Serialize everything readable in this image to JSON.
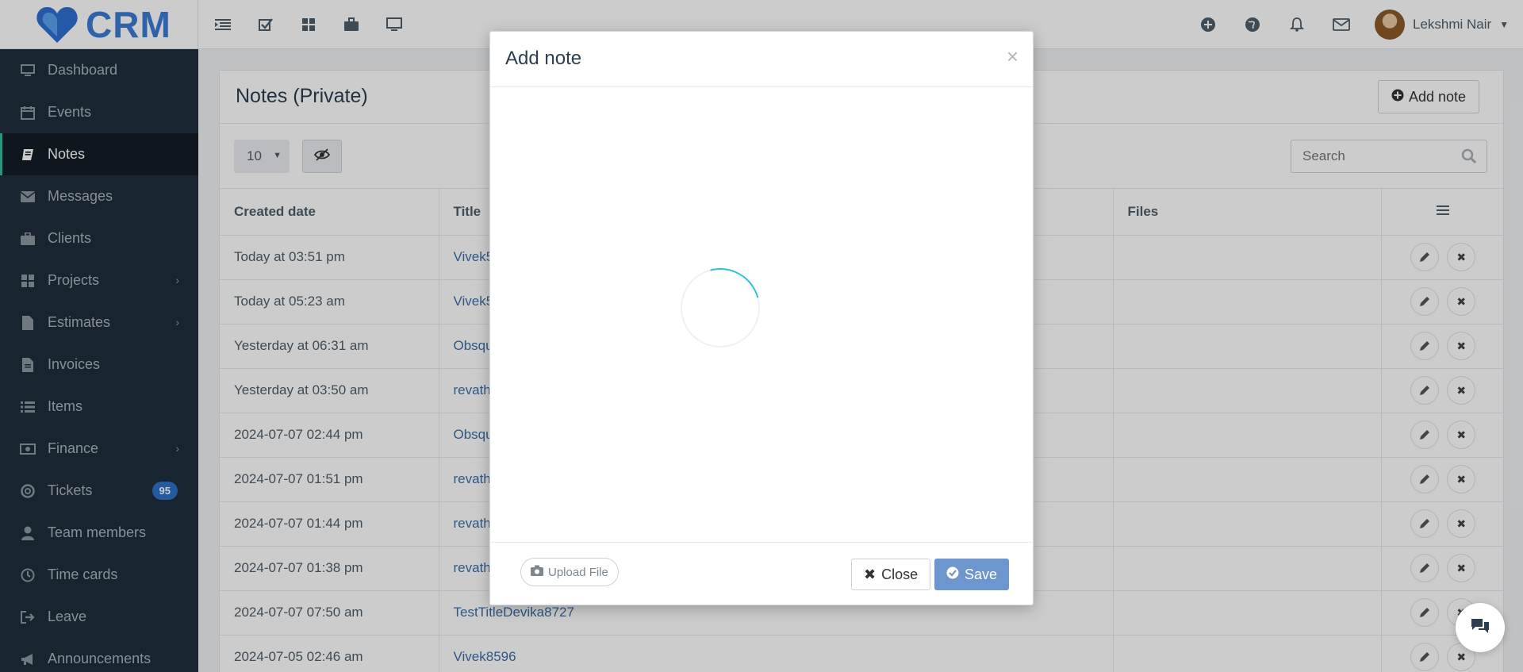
{
  "app": {
    "logo_text": "CRM"
  },
  "user": {
    "name": "Lekshmi Nair"
  },
  "sidebar": {
    "items": [
      {
        "label": "Dashboard",
        "icon": "desktop-icon"
      },
      {
        "label": "Events",
        "icon": "calendar-icon"
      },
      {
        "label": "Notes",
        "icon": "book-icon",
        "active": true
      },
      {
        "label": "Messages",
        "icon": "envelope-icon"
      },
      {
        "label": "Clients",
        "icon": "briefcase-icon"
      },
      {
        "label": "Projects",
        "icon": "grid-icon",
        "has_submenu": true
      },
      {
        "label": "Estimates",
        "icon": "file-icon",
        "has_submenu": true
      },
      {
        "label": "Invoices",
        "icon": "file-text-icon"
      },
      {
        "label": "Items",
        "icon": "list-icon"
      },
      {
        "label": "Finance",
        "icon": "money-icon",
        "has_submenu": true
      },
      {
        "label": "Tickets",
        "icon": "lifebuoy-icon",
        "badge": "95"
      },
      {
        "label": "Team members",
        "icon": "user-icon"
      },
      {
        "label": "Time cards",
        "icon": "clock-icon"
      },
      {
        "label": "Leave",
        "icon": "sign-out-icon"
      },
      {
        "label": "Announcements",
        "icon": "bullhorn-icon"
      }
    ]
  },
  "notes_panel": {
    "title": "Notes (Private)",
    "add_note_label": "Add note",
    "page_length": "10",
    "search_placeholder": "Search",
    "columns": [
      "Created date",
      "Title",
      "Files"
    ],
    "rows": [
      {
        "date": "Today at 03:51 pm",
        "title": "Vivek5"
      },
      {
        "date": "Today at 05:23 am",
        "title": "Vivek5"
      },
      {
        "date": "Yesterday at 06:31 am",
        "title": "Obsqu"
      },
      {
        "date": "Yesterday at 03:50 am",
        "title": "revath"
      },
      {
        "date": "2024-07-07 02:44 pm",
        "title": "Obsqu"
      },
      {
        "date": "2024-07-07 01:51 pm",
        "title": "revath"
      },
      {
        "date": "2024-07-07 01:44 pm",
        "title": "revath"
      },
      {
        "date": "2024-07-07 01:38 pm",
        "title": "revath"
      },
      {
        "date": "2024-07-07 07:50 am",
        "title": "TestTitleDevika8727"
      },
      {
        "date": "2024-07-05 02:46 am",
        "title": "Vivek8596"
      }
    ]
  },
  "modal": {
    "title": "Add note",
    "upload_label": "Upload File",
    "close_label": "Close",
    "save_label": "Save"
  },
  "colors": {
    "sidebar_bg": "#1f2d3d",
    "accent": "#2ebd9c",
    "link": "#3b6ea8",
    "save_button": "#6d96cf",
    "badge": "#2f71c6"
  }
}
